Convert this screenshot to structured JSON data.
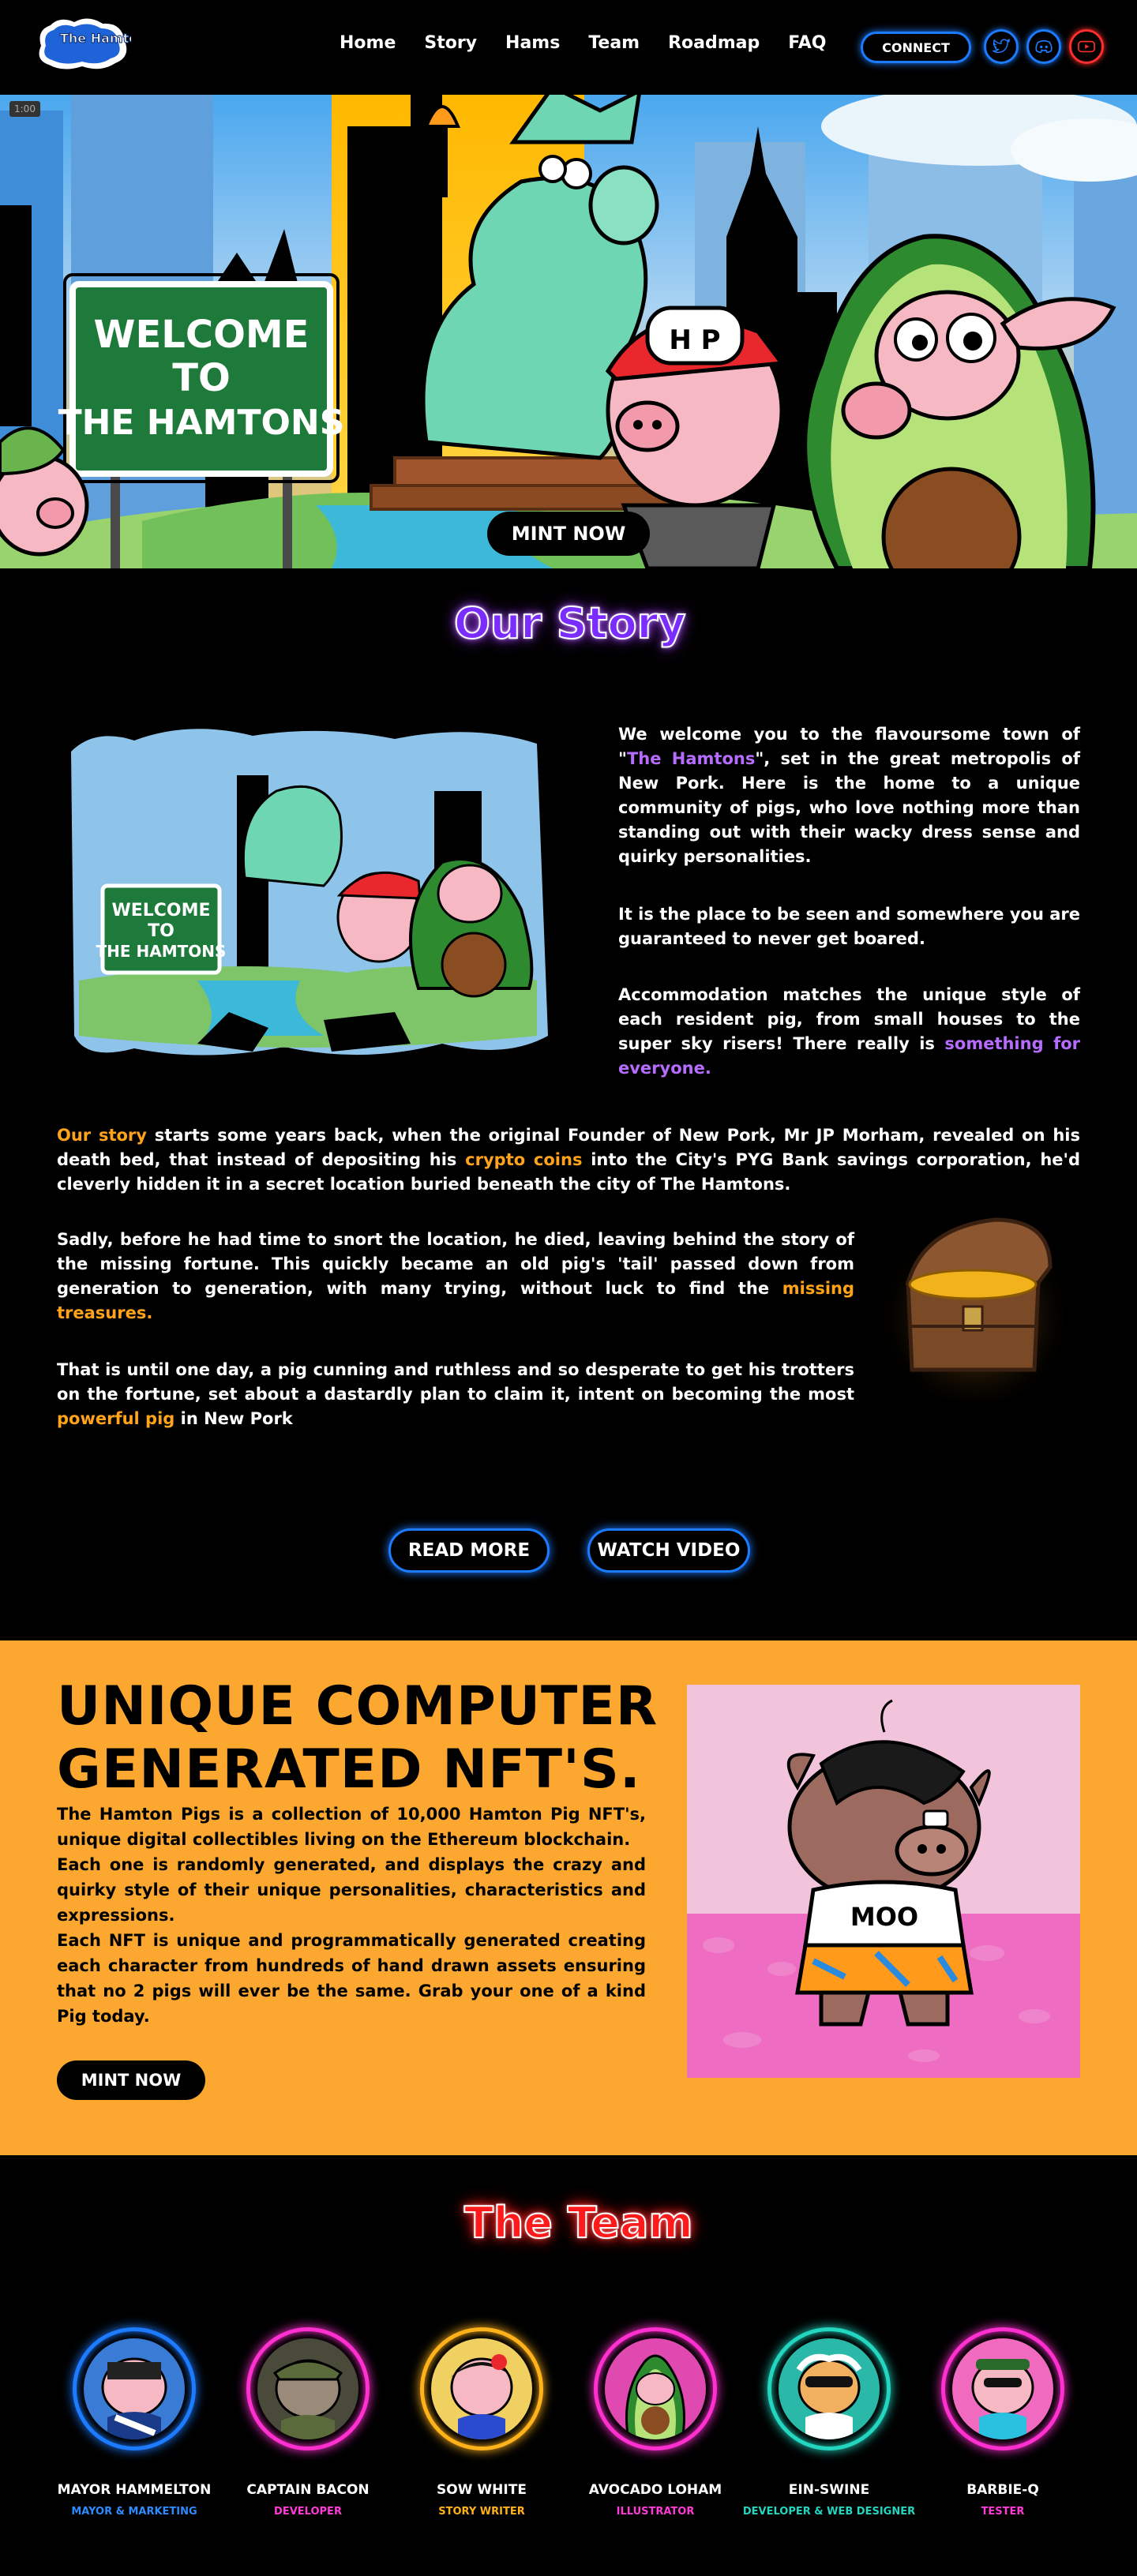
{
  "nav": {
    "logo_text": "The Hamtons",
    "links": [
      "Home",
      "Story",
      "Hams",
      "Team",
      "Roadmap",
      "FAQ"
    ],
    "connect_label": "CONNECT",
    "social_icons": [
      "twitter-icon",
      "discord-icon",
      "youtube-icon"
    ]
  },
  "hero": {
    "timestamp": "1:00",
    "sign_lines": [
      "WELCOME",
      "TO",
      "THE HAMTONS"
    ],
    "cap_text": "H P",
    "mint_label": "MINT NOW"
  },
  "story": {
    "title": "Our Story",
    "img_sign_lines": [
      "WELCOME",
      "TO",
      "THE HAMTONS"
    ],
    "p1_a": "We welcome you to the flavoursome town of \"",
    "p1_hl": "The Hamtons",
    "p1_b": "\", set in the great metropolis of New Pork. Here is the home to a unique community of pigs, who love nothing more than standing out with their wacky dress sense and quirky personalities.",
    "p2": "It is the place to be seen and somewhere you are guaranteed to never get boared.",
    "p3_a": "Accommodation matches the unique style of each resident pig, from small houses to the super sky risers! There really is ",
    "p3_hl": "something for everyone.",
    "p4_hl1": "Our story",
    "p4_a": " starts some years back, when the original Founder of New Pork, Mr JP Morham, revealed on his death bed, that instead of depositing his ",
    "p4_hl2": "crypto coins",
    "p4_b": " into the City's PYG Bank savings corporation, he'd cleverly hidden it in a secret location buried beneath the city of The Hamtons.",
    "p5_a": "Sadly, before he had time to snort the location, he died, leaving behind the story of the missing fortune. This quickly became an old pig's 'tail' passed down from generation to generation, with many trying, without luck to find the ",
    "p5_hl": "missing treasures.",
    "p6_a": "That is until one day, a pig cunning and ruthless and so desperate to get his trotters on the fortune, set about a dastardly plan to claim it, intent on becoming the most ",
    "p6_hl": "powerful pig",
    "p6_b": " in New Pork",
    "read_more_label": "READ MORE",
    "watch_video_label": "WATCH VIDEO"
  },
  "nft": {
    "title_line1": "UNIQUE COMPUTER",
    "title_line2": "GENERATED NFT'S.",
    "p1": "The Hamton Pigs is a collection of 10,000 Hamton Pig NFT's, unique digital collectibles living on the Ethereum blockchain.",
    "p2": "Each one is randomly generated, and displays the crazy and quirky style of their unique personalities, characteristics and expressions.",
    "p3": "Each NFT is unique and programmatically generated creating each character from hundreds of hand drawn assets ensuring that no 2 pigs will ever be the same. Grab your one of a kind Pig today.",
    "mint_label": "MINT NOW",
    "shirt_text": "MOO"
  },
  "team": {
    "title": "The Team",
    "members": [
      {
        "name": "MAYOR HAMMELTON",
        "role": "MAYOR & MARKETING",
        "ring": "#1d7bff",
        "role_color": "#2e8bff"
      },
      {
        "name": "CAPTAIN BACON",
        "role": "DEVELOPER",
        "ring": "#ff2fd0",
        "role_color": "#ff3ad6"
      },
      {
        "name": "SOW WHITE",
        "role": "STORY WRITER",
        "ring": "#ffb21a",
        "role_color": "#ffb21a"
      },
      {
        "name": "AVOCADO LOHAM",
        "role": "ILLUSTRATOR",
        "ring": "#ff2fd0",
        "role_color": "#ff3ad6"
      },
      {
        "name": "EIN-SWINE",
        "role": "DEVELOPER & WEB DESIGNER",
        "ring": "#22d6c0",
        "role_color": "#22d6c0"
      },
      {
        "name": "BARBIE-Q",
        "role": "TESTER",
        "ring": "#ff2fd0",
        "role_color": "#ff3ad6"
      }
    ]
  }
}
